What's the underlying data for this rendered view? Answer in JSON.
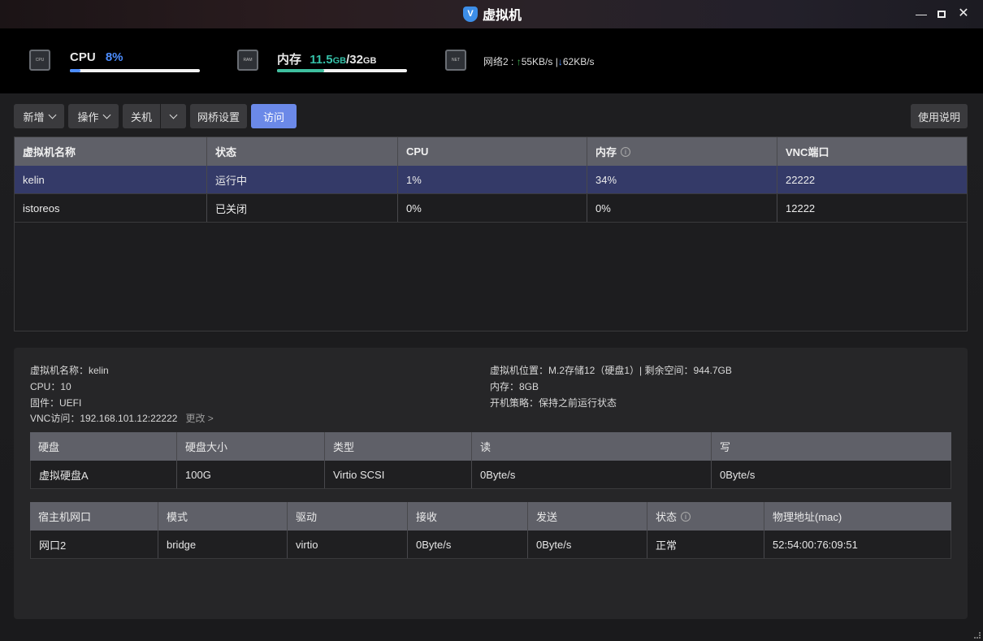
{
  "window": {
    "title": "虚拟机",
    "app_icon": "V"
  },
  "stats": {
    "cpu": {
      "label": "CPU",
      "value": "8%",
      "percent": 8,
      "color": "#4c8dff"
    },
    "memory": {
      "label": "内存",
      "used": "11.5",
      "used_unit": "GB",
      "sep": "/",
      "total": "32",
      "total_unit": "GB",
      "percent": 36,
      "color": "#3fbf9f"
    },
    "network": {
      "label": "网络2 :",
      "up": "55KB/s",
      "sep": "|",
      "down": "62KB/s"
    },
    "icons": {
      "cpu": "CPU",
      "ram": "RAM",
      "net": "NET"
    }
  },
  "toolbar": {
    "new_label": "新增",
    "action_label": "操作",
    "shutdown_label": "关机",
    "bridge_label": "网桥设置",
    "visit_label": "访问",
    "help_label": "使用说明"
  },
  "vm_table": {
    "columns": [
      "虚拟机名称",
      "状态",
      "CPU",
      "内存",
      "VNC端口"
    ],
    "rows": [
      {
        "name": "kelin",
        "status": "运行中",
        "cpu": "1%",
        "mem": "34%",
        "vnc": "22222"
      },
      {
        "name": "istoreos",
        "status": "已关闭",
        "cpu": "0%",
        "mem": "0%",
        "vnc": "12222"
      }
    ]
  },
  "detail": {
    "name": "虚拟机名称：kelin",
    "cpu": "CPU：10",
    "firmware": "固件：UEFI",
    "vnc": "VNC访问：192.168.101.12:22222",
    "change": "更改 >",
    "location": "虚拟机位置：M.2存储12（硬盘1）| 剩余空间：944.7GB",
    "memory": "内存：8GB",
    "boot_policy": "开机策略：保持之前运行状态"
  },
  "disk_table": {
    "columns": [
      "硬盘",
      "硬盘大小",
      "类型",
      "读",
      "写"
    ],
    "rows": [
      {
        "disk": "虚拟硬盘A",
        "size": "100G",
        "type": "Virtio SCSI",
        "read": "0Byte/s",
        "write": "0Byte/s"
      }
    ]
  },
  "net_table": {
    "columns": [
      "宿主机网口",
      "模式",
      "驱动",
      "接收",
      "发送",
      "状态",
      "物理地址(mac)"
    ],
    "rows": [
      {
        "port": "网口2",
        "mode": "bridge",
        "driver": "virtio",
        "rx": "0Byte/s",
        "tx": "0Byte/s",
        "status": "正常",
        "mac": "52:54:00:76:09:51"
      }
    ]
  }
}
